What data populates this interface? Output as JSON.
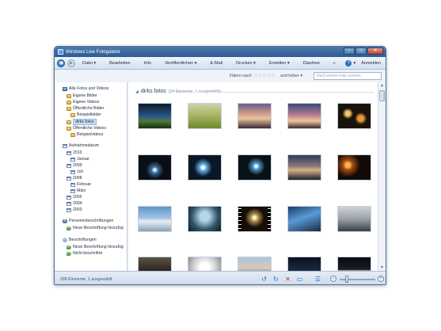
{
  "window": {
    "title": "Windows Live Fotogalerie"
  },
  "menu": {
    "items": [
      "Datei ▾",
      "Bearbeiten",
      "Info",
      "Veröffentlichen ▾",
      "E-Mail",
      "Drucken ▾",
      "Erstellen ▾",
      "Diashow",
      "»"
    ],
    "help": "?",
    "help_caret": "▾",
    "login": "Anmelden"
  },
  "filter": {
    "label": "Filtern nach",
    "stars": "☆☆☆☆☆",
    "value": "und höher ▾",
    "search_placeholder": "Nach einem Foto suchen"
  },
  "sidebar": {
    "all_photos": "Alle Fotos und Videos",
    "own_pictures": "Eigene Bilder",
    "own_videos": "Eigene Videos",
    "public_pictures": "Öffentliche Bilder",
    "sample_pictures": "Beispielbilder",
    "dirks_fotos": "dirks fotos",
    "public_videos": "Öffentliche Videos",
    "sample_videos": "Beispielvideos",
    "date_taken": "Aufnahmedatum",
    "years": [
      "2010",
      "Januar",
      "2009",
      "Juli",
      "2008",
      "Februar",
      "März",
      "2005",
      "2004",
      "2003"
    ],
    "people_tags": "Personenbeschriftungen",
    "new_people_tag": "Neue Beschriftung hinzufüg",
    "tags": "Beschriftungen",
    "new_tag": "Neue Beschriftung hinzufüg",
    "not_tagged": "Nicht beschriftet"
  },
  "content": {
    "folder_name": "dirks fotos",
    "count": "(24 Elemente, 1 ausgewählt)",
    "thumbnails": [
      {
        "name": "photo-night-landscape",
        "bg": "linear-gradient(#0d1a2a 0%, #2a5d8a 55%, #4e7a3a 70%, #173010 100%)"
      },
      {
        "name": "photo-field",
        "bg": "linear-gradient(#c9d3a8 0%, #aebb6c 40%, #6f8a2e 100%)"
      },
      {
        "name": "photo-sunset-haze",
        "bg": "linear-gradient(#6a5d8c 0%, #d9a28a 45%, #e8c39d 60%, #3b2a35 100%)"
      },
      {
        "name": "photo-sunset-sky",
        "bg": "linear-gradient(#3a4a7a 0%, #b47b8f 45%, #f0c69b 70%, #3a2a30 100%)"
      },
      {
        "name": "photo-bokeh-night",
        "bg": "radial-gradient(circle at 30% 40%, #f7c86b 8%, transparent 20%), radial-gradient(circle at 70% 60%, #e59b3c 10%, transparent 22%), #1a130c"
      },
      {
        "name": "photo-light-trails",
        "bg": "radial-gradient(circle at 50% 60%, #cfe8ff 6%, #3d6f9e 14%, #0a0f17 40%)"
      },
      {
        "name": "photo-light-burst",
        "bg": "radial-gradient(circle at 45% 50%, #ffffff 6%, #6ab6f0 14%, #0b1726 42%)"
      },
      {
        "name": "photo-fireworks",
        "bg": "radial-gradient(circle at 55% 45%, #e7f6ff 5%, #4a8fbf 15%, #081018 40%)"
      },
      {
        "name": "photo-dusk-sea",
        "bg": "linear-gradient(#2a3a5a 0%, #8a7a7a 45%, #d8b08a 60%, #1b2230 100%)"
      },
      {
        "name": "photo-fire-night",
        "bg": "radial-gradient(circle at 30% 40%, #ffb24a 8%, #a34c10 18%, #120a05 45%)"
      },
      {
        "name": "photo-blue-sky",
        "bg": "linear-gradient(#5d97cc 0%, #9fc3e3 45%, #e8eef3 60%, #8aa2b8 100%)"
      },
      {
        "name": "photo-tree-silhouette",
        "bg": "radial-gradient(circle at 50% 40%, #b6d7e8 20%, #2f5466 60%, #0e1d24 100%)"
      },
      {
        "name": "photo-filmstrip-city",
        "bg": "radial-gradient(circle at 50% 45%, #fff3d0 6%, #b08a4a 18%, #160f08 45%)"
      },
      {
        "name": "photo-blue-rays",
        "bg": "linear-gradient(160deg, #1b3b6a 0%, #5a9ad6 45%, #1b2a44 100%)"
      },
      {
        "name": "photo-grey-scene",
        "bg": "linear-gradient(#cfd3d6 0%, #9aa1a6 50%, #3b4045 100%)"
      },
      {
        "name": "photo-dark-interior",
        "bg": "linear-gradient(#5a5246 0%, #2b2620 55%, #0e0c0a 100%)"
      },
      {
        "name": "photo-white-room",
        "bg": "radial-gradient(circle at 50% 40%, #ffffff 20%, #c9c9c9 55%, #6e6e6e 100%)"
      },
      {
        "name": "photo-coast",
        "bg": "linear-gradient(#a8c6e0 0%, #d9c9b6 45%, #7a8a9a 65%, #3a4654 100%)"
      },
      {
        "name": "photo-night-harbour",
        "bg": "linear-gradient(#0a1020 0%, #1d2a44 55%, #b7c6e0 60%, #0a1020 100%)"
      },
      {
        "name": "photo-night-lights",
        "bg": "linear-gradient(#0b0b12 0%, #1b1b2a 50%, #e6d89a 55%, #0b0b12 100%)"
      }
    ]
  },
  "status": {
    "text": "288 Elemente, 1 ausgewählt"
  },
  "icons": {
    "back": "◀",
    "forward": "▶",
    "rotate_left": "↺",
    "rotate_right": "↻",
    "delete": "✕",
    "slideshow": "▭",
    "view_details": "☰",
    "zoom_minus": "–",
    "zoom_plus": "+",
    "scroll_up": "▲",
    "scroll_down": "▼"
  }
}
